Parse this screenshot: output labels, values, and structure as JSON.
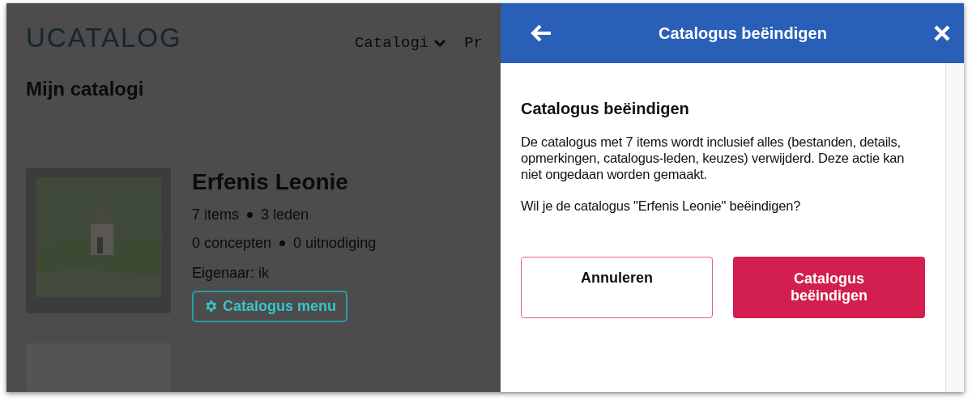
{
  "app": {
    "logo": "UCATALOG",
    "nav": [
      {
        "label": "Catalogi",
        "kind": "dropdown"
      },
      {
        "label": "Pr",
        "kind": "link"
      }
    ]
  },
  "page": {
    "title": "Mijn catalogi",
    "catalogs": [
      {
        "kind": "catalog",
        "title": "Erfenis Leonie",
        "stats": [
          [
            "7 items",
            "3 leden"
          ],
          [
            "0 concepten",
            "0 uitnodiging"
          ]
        ],
        "owner": "Eigenaar: ik",
        "menu_button": "Catalogus menu"
      },
      {
        "kind": "placeholder"
      }
    ]
  },
  "panel": {
    "title": "Catalogus beëindigen",
    "heading": "Catalogus beëindigen",
    "message": "De catalogus met 7 items wordt inclusief alles (bestanden, details, opmerkingen, catalogus-leden, keuzes) verwijderd. Deze actie kan niet ongedaan worden gemaakt.",
    "question": "Wil je de catalogus \"Erfenis Leonie\" beëindigen?",
    "buttons": [
      {
        "label": "Annuleren",
        "kind": "secondary"
      },
      {
        "label": "Catalogus beëindigen",
        "kind": "danger"
      }
    ]
  }
}
